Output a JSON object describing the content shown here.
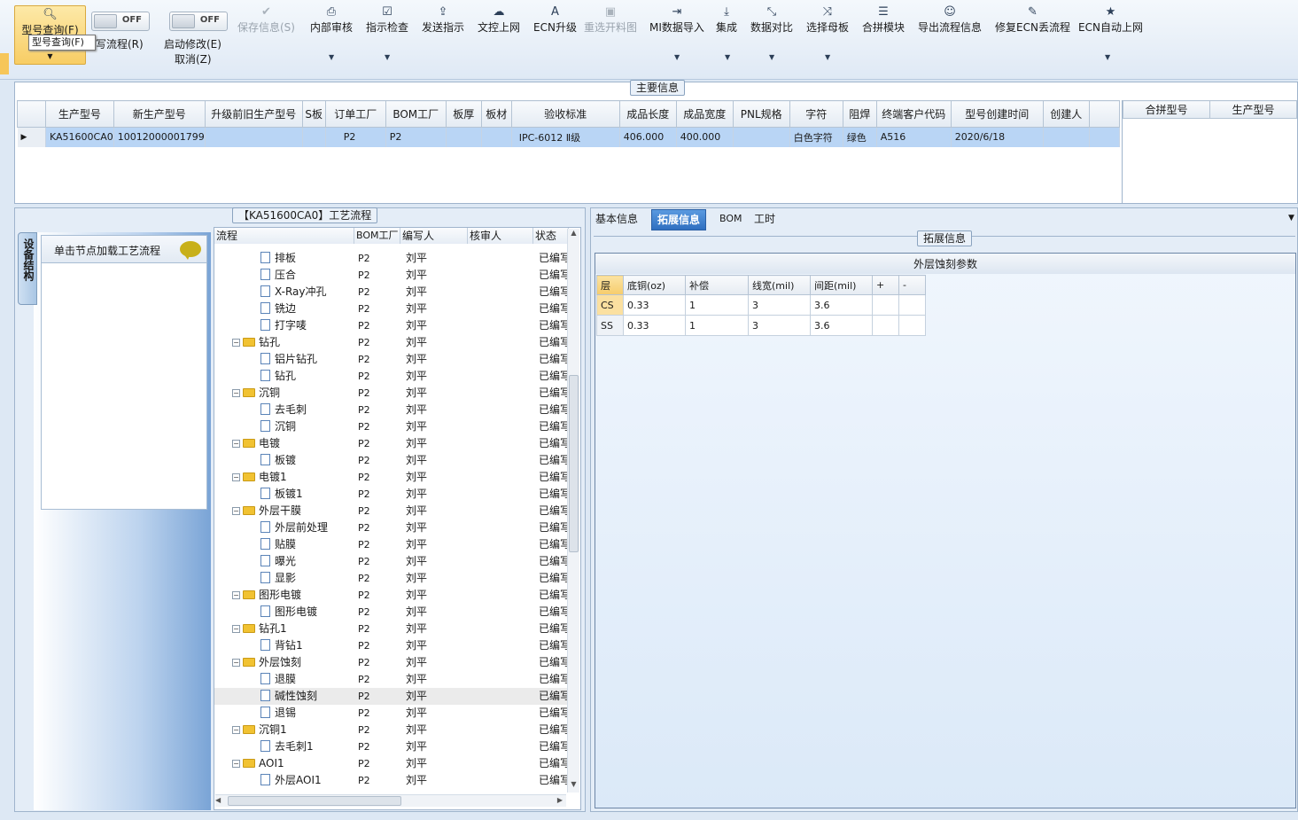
{
  "toolbar": {
    "query": {
      "label": "型号查询(F)",
      "tooltip": "型号查询(F)"
    },
    "write_flow": {
      "label": "写流程(R)",
      "toggle": "OFF"
    },
    "start_edit": {
      "label": "启动修改(E)",
      "toggle": "OFF",
      "cancel": "取消(Z)"
    },
    "save": "保存信息(S)",
    "internal_review": "内部审核",
    "check": "指示检查",
    "send": "发送指示",
    "pdc_online": "文控上网",
    "ecn_upgrade": "ECN升级",
    "reselect": "重选开料图",
    "mi_import": "MI数据导入",
    "integrate": "集成",
    "compare": "数据对比",
    "select_master": "选择母板",
    "merge_module": "合拼模块",
    "export_flow": "导出流程信息",
    "fix_ecn": "修复ECN丢流程",
    "ecn_auto": "ECN自动上网"
  },
  "main_info": {
    "title": "主要信息",
    "columns": [
      "生产型号",
      "新生产型号",
      "升级前旧生产型号",
      "S板",
      "订单工厂",
      "BOM工厂",
      "板厚",
      "板材",
      "验收标准",
      "成品长度",
      "成品宽度",
      "PNL规格",
      "字符",
      "阻焊",
      "终端客户代码",
      "型号创建时间",
      "创建人"
    ],
    "row": [
      "KA51600CA0",
      "10012000001799",
      "",
      "",
      "P2",
      "P2",
      "",
      "",
      "IPC-6012 Ⅱ级",
      "406.000",
      "400.000",
      "",
      "白色字符",
      "绿色",
      "A516",
      "2020/6/18",
      ""
    ],
    "side_columns": [
      "合拼型号",
      "生产型号"
    ]
  },
  "process": {
    "title": "【KA51600CA0】工艺流程",
    "side_tab": "设备结构",
    "load_hint": "单击节点加载工艺流程",
    "columns": [
      "流程",
      "BOM工厂",
      "编写人",
      "核审人",
      "状态"
    ],
    "rows": [
      {
        "name": "排板",
        "level": 2,
        "factory": "P2",
        "writer": "刘平",
        "status": "已编写"
      },
      {
        "name": "压合",
        "level": 2,
        "factory": "P2",
        "writer": "刘平",
        "status": "已编写"
      },
      {
        "name": "X-Ray冲孔",
        "level": 2,
        "factory": "P2",
        "writer": "刘平",
        "status": "已编写"
      },
      {
        "name": "铣边",
        "level": 2,
        "factory": "P2",
        "writer": "刘平",
        "status": "已编写"
      },
      {
        "name": "打字唛",
        "level": 2,
        "factory": "P2",
        "writer": "刘平",
        "status": "已编写"
      },
      {
        "name": "钻孔",
        "level": 1,
        "factory": "P2",
        "writer": "刘平",
        "status": "已编写"
      },
      {
        "name": "铝片钻孔",
        "level": 2,
        "factory": "P2",
        "writer": "刘平",
        "status": "已编写"
      },
      {
        "name": "钻孔",
        "level": 2,
        "factory": "P2",
        "writer": "刘平",
        "status": "已编写"
      },
      {
        "name": "沉铜",
        "level": 1,
        "factory": "P2",
        "writer": "刘平",
        "status": "已编写"
      },
      {
        "name": "去毛刺",
        "level": 2,
        "factory": "P2",
        "writer": "刘平",
        "status": "已编写"
      },
      {
        "name": "沉铜",
        "level": 2,
        "factory": "P2",
        "writer": "刘平",
        "status": "已编写"
      },
      {
        "name": "电镀",
        "level": 1,
        "factory": "P2",
        "writer": "刘平",
        "status": "已编写"
      },
      {
        "name": "板镀",
        "level": 2,
        "factory": "P2",
        "writer": "刘平",
        "status": "已编写"
      },
      {
        "name": "电镀1",
        "level": 1,
        "factory": "P2",
        "writer": "刘平",
        "status": "已编写"
      },
      {
        "name": "板镀1",
        "level": 2,
        "factory": "P2",
        "writer": "刘平",
        "status": "已编写"
      },
      {
        "name": "外层干膜",
        "level": 1,
        "factory": "P2",
        "writer": "刘平",
        "status": "已编写"
      },
      {
        "name": "外层前处理",
        "level": 2,
        "factory": "P2",
        "writer": "刘平",
        "status": "已编写"
      },
      {
        "name": "贴膜",
        "level": 2,
        "factory": "P2",
        "writer": "刘平",
        "status": "已编写"
      },
      {
        "name": "曝光",
        "level": 2,
        "factory": "P2",
        "writer": "刘平",
        "status": "已编写"
      },
      {
        "name": "显影",
        "level": 2,
        "factory": "P2",
        "writer": "刘平",
        "status": "已编写"
      },
      {
        "name": "图形电镀",
        "level": 1,
        "factory": "P2",
        "writer": "刘平",
        "status": "已编写"
      },
      {
        "name": "图形电镀",
        "level": 2,
        "factory": "P2",
        "writer": "刘平",
        "status": "已编写"
      },
      {
        "name": "钻孔1",
        "level": 1,
        "factory": "P2",
        "writer": "刘平",
        "status": "已编写"
      },
      {
        "name": "背钻1",
        "level": 2,
        "factory": "P2",
        "writer": "刘平",
        "status": "已编写"
      },
      {
        "name": "外层蚀刻",
        "level": 1,
        "factory": "P2",
        "writer": "刘平",
        "status": "已编写"
      },
      {
        "name": "退膜",
        "level": 2,
        "factory": "P2",
        "writer": "刘平",
        "status": "已编写"
      },
      {
        "name": "碱性蚀刻",
        "level": 2,
        "factory": "P2",
        "writer": "刘平",
        "status": "已编写",
        "selected": true
      },
      {
        "name": "退锡",
        "level": 2,
        "factory": "P2",
        "writer": "刘平",
        "status": "已编写"
      },
      {
        "name": "沉铜1",
        "level": 1,
        "factory": "P2",
        "writer": "刘平",
        "status": "已编写"
      },
      {
        "name": "去毛刺1",
        "level": 2,
        "factory": "P2",
        "writer": "刘平",
        "status": "已编写"
      },
      {
        "name": "AOI1",
        "level": 1,
        "factory": "P2",
        "writer": "刘平",
        "status": "已编写"
      },
      {
        "name": "外层AOI1",
        "level": 2,
        "factory": "P2",
        "writer": "刘平",
        "status": "已编写"
      }
    ]
  },
  "detail": {
    "tabs": [
      "基本信息",
      "拓展信息",
      "BOM",
      "工时"
    ],
    "group_title": "拓展信息",
    "table_title": "外层蚀刻参数",
    "columns": [
      "层",
      "底铜(oz)",
      "补偿",
      "线宽(mil)",
      "间距(mil)",
      "+",
      "-"
    ],
    "rows": [
      [
        "CS",
        "0.33",
        "1",
        "3",
        "3.6",
        "",
        ""
      ],
      [
        "SS",
        "0.33",
        "1",
        "3",
        "3.6",
        "",
        ""
      ]
    ]
  }
}
